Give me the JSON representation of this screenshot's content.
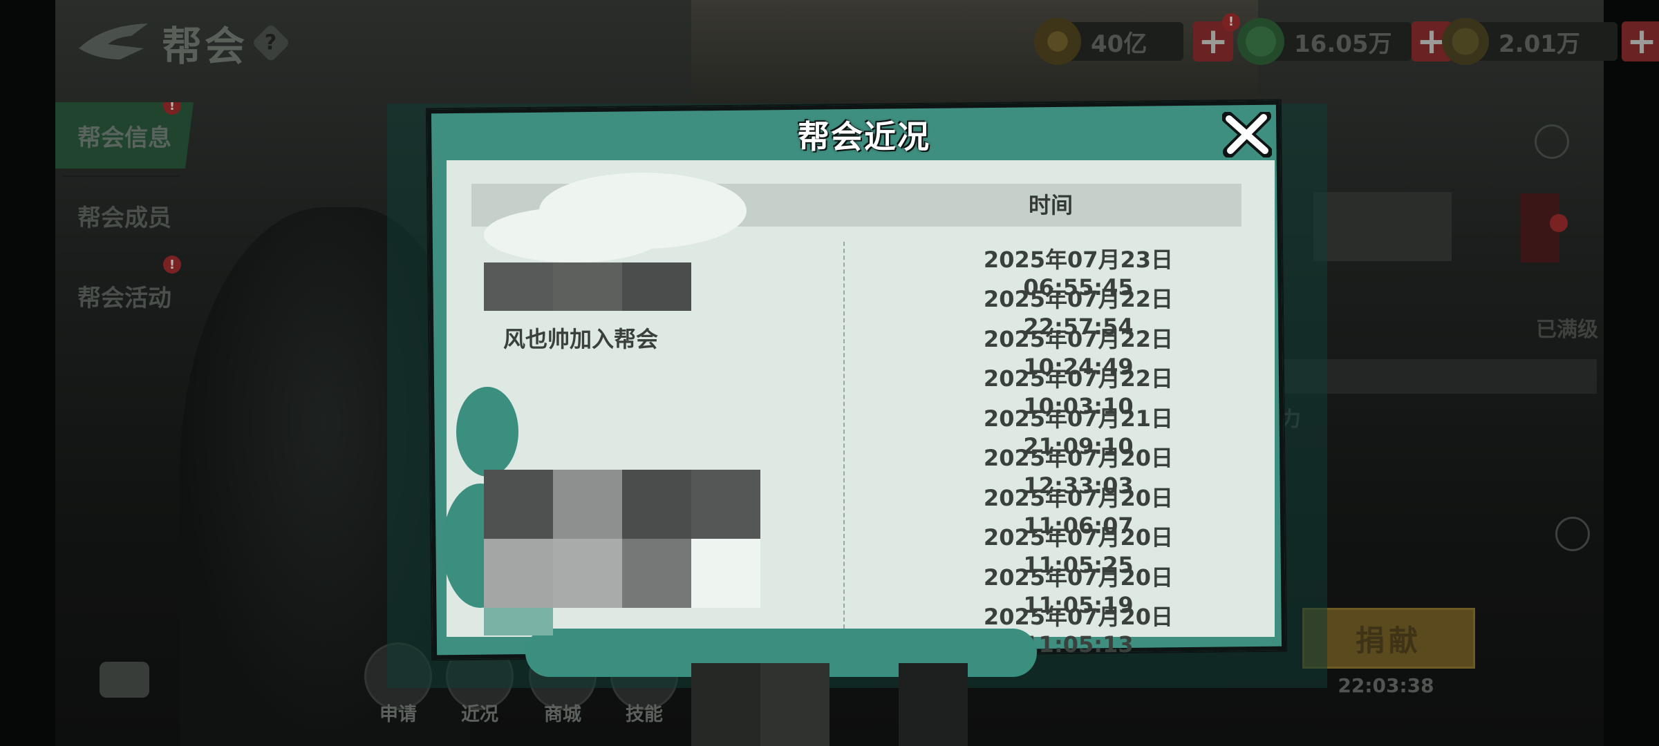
{
  "header": {
    "title": "帮会",
    "help_symbol": "?",
    "currencies": [
      {
        "icon": "copper-coin-icon",
        "value": "40亿",
        "badge": "!"
      },
      {
        "icon": "jade-icon",
        "value": "16.05万"
      },
      {
        "icon": "gold-token-icon",
        "value": "2.01万"
      }
    ]
  },
  "sidebar": {
    "tabs": [
      {
        "label": "帮会信息",
        "active": true,
        "badge": "!"
      },
      {
        "label": "帮会成员",
        "active": false
      },
      {
        "label": "帮会活动",
        "active": false,
        "badge": "!"
      }
    ]
  },
  "right_panel": {
    "max_level_text": "已满级",
    "partial_text": "力",
    "donate_label": "捐献",
    "donate_time": "22:03:38"
  },
  "toolbar": {
    "buttons": [
      {
        "label": "申请",
        "icon": "apply-scroll-icon"
      },
      {
        "label": "近况",
        "icon": "news-book-icon"
      },
      {
        "label": "商城",
        "icon": "shop-icon"
      },
      {
        "label": "技能",
        "icon": "skill-icon"
      }
    ]
  },
  "modal": {
    "title": "帮会近况",
    "close_symbol": "✕",
    "time_header": "时间",
    "rows": [
      {
        "event": "",
        "time": "2025年07月23日 06:55:45"
      },
      {
        "event": "加入帮会",
        "time": "2025年07月22日 22:57:54"
      },
      {
        "event": "风也帅加入帮会",
        "time": "2025年07月22日 10:24:49"
      },
      {
        "event": "",
        "time": "2025年07月22日 10:03:10"
      },
      {
        "event": "",
        "time": "2025年07月21日 21:09:10"
      },
      {
        "event": "",
        "time": "2025年07月20日 12:33:03"
      },
      {
        "event": "",
        "time": "2025年07月20日 11:06:07"
      },
      {
        "event": "",
        "time": "2025年07月20日 11:05:25"
      },
      {
        "event": "",
        "time": "2025年07月20日 11:05:19"
      },
      {
        "event": "",
        "time": "2025年07月20日 11:05:13"
      }
    ]
  },
  "colors": {
    "modal_teal": "#3f8f80",
    "modal_body": "#dfe9e3",
    "table_header": "#c6d0cb",
    "text_dark": "#3a403c",
    "active_tab": "#21442f",
    "donate_gold": "#5a4a1e"
  }
}
